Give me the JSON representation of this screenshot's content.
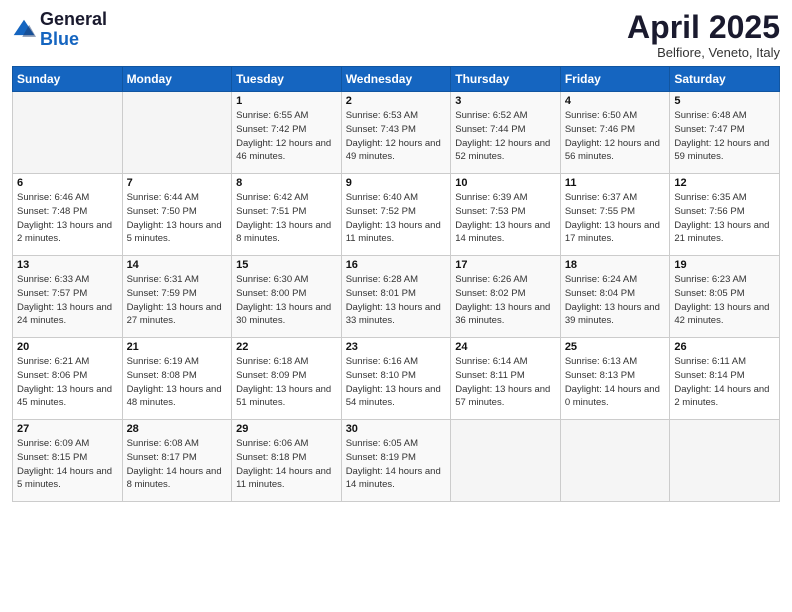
{
  "header": {
    "logo_general": "General",
    "logo_blue": "Blue",
    "month": "April 2025",
    "location": "Belfiore, Veneto, Italy"
  },
  "columns": [
    "Sunday",
    "Monday",
    "Tuesday",
    "Wednesday",
    "Thursday",
    "Friday",
    "Saturday"
  ],
  "weeks": [
    [
      {
        "day": "",
        "sunrise": "",
        "sunset": "",
        "daylight": ""
      },
      {
        "day": "",
        "sunrise": "",
        "sunset": "",
        "daylight": ""
      },
      {
        "day": "1",
        "sunrise": "Sunrise: 6:55 AM",
        "sunset": "Sunset: 7:42 PM",
        "daylight": "Daylight: 12 hours and 46 minutes."
      },
      {
        "day": "2",
        "sunrise": "Sunrise: 6:53 AM",
        "sunset": "Sunset: 7:43 PM",
        "daylight": "Daylight: 12 hours and 49 minutes."
      },
      {
        "day": "3",
        "sunrise": "Sunrise: 6:52 AM",
        "sunset": "Sunset: 7:44 PM",
        "daylight": "Daylight: 12 hours and 52 minutes."
      },
      {
        "day": "4",
        "sunrise": "Sunrise: 6:50 AM",
        "sunset": "Sunset: 7:46 PM",
        "daylight": "Daylight: 12 hours and 56 minutes."
      },
      {
        "day": "5",
        "sunrise": "Sunrise: 6:48 AM",
        "sunset": "Sunset: 7:47 PM",
        "daylight": "Daylight: 12 hours and 59 minutes."
      }
    ],
    [
      {
        "day": "6",
        "sunrise": "Sunrise: 6:46 AM",
        "sunset": "Sunset: 7:48 PM",
        "daylight": "Daylight: 13 hours and 2 minutes."
      },
      {
        "day": "7",
        "sunrise": "Sunrise: 6:44 AM",
        "sunset": "Sunset: 7:50 PM",
        "daylight": "Daylight: 13 hours and 5 minutes."
      },
      {
        "day": "8",
        "sunrise": "Sunrise: 6:42 AM",
        "sunset": "Sunset: 7:51 PM",
        "daylight": "Daylight: 13 hours and 8 minutes."
      },
      {
        "day": "9",
        "sunrise": "Sunrise: 6:40 AM",
        "sunset": "Sunset: 7:52 PM",
        "daylight": "Daylight: 13 hours and 11 minutes."
      },
      {
        "day": "10",
        "sunrise": "Sunrise: 6:39 AM",
        "sunset": "Sunset: 7:53 PM",
        "daylight": "Daylight: 13 hours and 14 minutes."
      },
      {
        "day": "11",
        "sunrise": "Sunrise: 6:37 AM",
        "sunset": "Sunset: 7:55 PM",
        "daylight": "Daylight: 13 hours and 17 minutes."
      },
      {
        "day": "12",
        "sunrise": "Sunrise: 6:35 AM",
        "sunset": "Sunset: 7:56 PM",
        "daylight": "Daylight: 13 hours and 21 minutes."
      }
    ],
    [
      {
        "day": "13",
        "sunrise": "Sunrise: 6:33 AM",
        "sunset": "Sunset: 7:57 PM",
        "daylight": "Daylight: 13 hours and 24 minutes."
      },
      {
        "day": "14",
        "sunrise": "Sunrise: 6:31 AM",
        "sunset": "Sunset: 7:59 PM",
        "daylight": "Daylight: 13 hours and 27 minutes."
      },
      {
        "day": "15",
        "sunrise": "Sunrise: 6:30 AM",
        "sunset": "Sunset: 8:00 PM",
        "daylight": "Daylight: 13 hours and 30 minutes."
      },
      {
        "day": "16",
        "sunrise": "Sunrise: 6:28 AM",
        "sunset": "Sunset: 8:01 PM",
        "daylight": "Daylight: 13 hours and 33 minutes."
      },
      {
        "day": "17",
        "sunrise": "Sunrise: 6:26 AM",
        "sunset": "Sunset: 8:02 PM",
        "daylight": "Daylight: 13 hours and 36 minutes."
      },
      {
        "day": "18",
        "sunrise": "Sunrise: 6:24 AM",
        "sunset": "Sunset: 8:04 PM",
        "daylight": "Daylight: 13 hours and 39 minutes."
      },
      {
        "day": "19",
        "sunrise": "Sunrise: 6:23 AM",
        "sunset": "Sunset: 8:05 PM",
        "daylight": "Daylight: 13 hours and 42 minutes."
      }
    ],
    [
      {
        "day": "20",
        "sunrise": "Sunrise: 6:21 AM",
        "sunset": "Sunset: 8:06 PM",
        "daylight": "Daylight: 13 hours and 45 minutes."
      },
      {
        "day": "21",
        "sunrise": "Sunrise: 6:19 AM",
        "sunset": "Sunset: 8:08 PM",
        "daylight": "Daylight: 13 hours and 48 minutes."
      },
      {
        "day": "22",
        "sunrise": "Sunrise: 6:18 AM",
        "sunset": "Sunset: 8:09 PM",
        "daylight": "Daylight: 13 hours and 51 minutes."
      },
      {
        "day": "23",
        "sunrise": "Sunrise: 6:16 AM",
        "sunset": "Sunset: 8:10 PM",
        "daylight": "Daylight: 13 hours and 54 minutes."
      },
      {
        "day": "24",
        "sunrise": "Sunrise: 6:14 AM",
        "sunset": "Sunset: 8:11 PM",
        "daylight": "Daylight: 13 hours and 57 minutes."
      },
      {
        "day": "25",
        "sunrise": "Sunrise: 6:13 AM",
        "sunset": "Sunset: 8:13 PM",
        "daylight": "Daylight: 14 hours and 0 minutes."
      },
      {
        "day": "26",
        "sunrise": "Sunrise: 6:11 AM",
        "sunset": "Sunset: 8:14 PM",
        "daylight": "Daylight: 14 hours and 2 minutes."
      }
    ],
    [
      {
        "day": "27",
        "sunrise": "Sunrise: 6:09 AM",
        "sunset": "Sunset: 8:15 PM",
        "daylight": "Daylight: 14 hours and 5 minutes."
      },
      {
        "day": "28",
        "sunrise": "Sunrise: 6:08 AM",
        "sunset": "Sunset: 8:17 PM",
        "daylight": "Daylight: 14 hours and 8 minutes."
      },
      {
        "day": "29",
        "sunrise": "Sunrise: 6:06 AM",
        "sunset": "Sunset: 8:18 PM",
        "daylight": "Daylight: 14 hours and 11 minutes."
      },
      {
        "day": "30",
        "sunrise": "Sunrise: 6:05 AM",
        "sunset": "Sunset: 8:19 PM",
        "daylight": "Daylight: 14 hours and 14 minutes."
      },
      {
        "day": "",
        "sunrise": "",
        "sunset": "",
        "daylight": ""
      },
      {
        "day": "",
        "sunrise": "",
        "sunset": "",
        "daylight": ""
      },
      {
        "day": "",
        "sunrise": "",
        "sunset": "",
        "daylight": ""
      }
    ]
  ]
}
